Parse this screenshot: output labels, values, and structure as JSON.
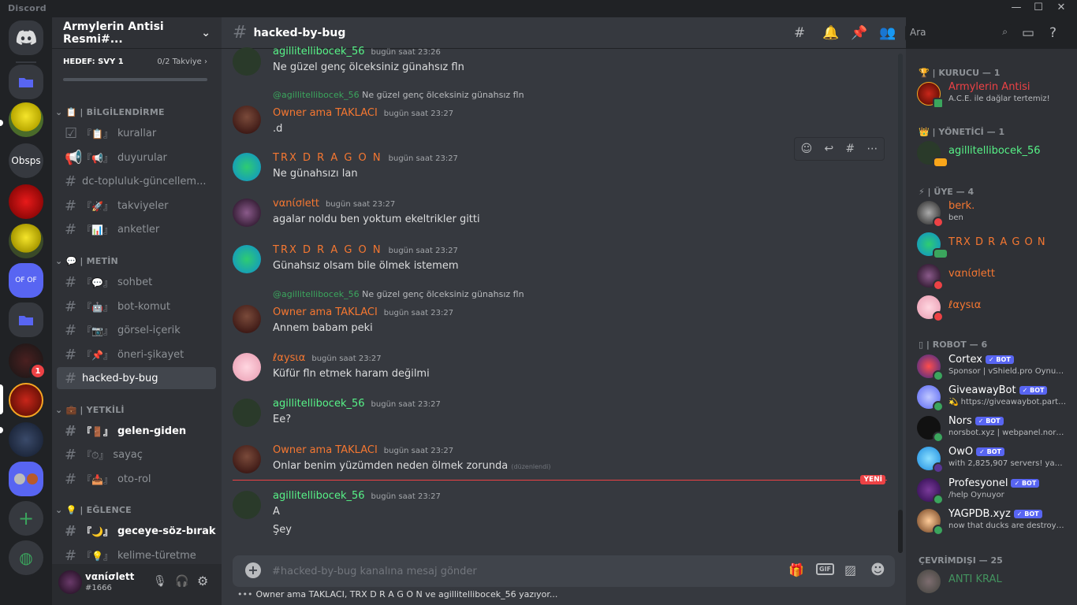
{
  "app": {
    "name": "Discord",
    "win_min": "—",
    "win_max": "☐",
    "win_close": "✕"
  },
  "rail": {
    "servers": [
      {
        "label": "Obsps"
      },
      {
        "badge": "1"
      }
    ]
  },
  "guild": {
    "name": "Armylerin Antisi Resmi#...",
    "boost_goal": "HEDEF: SVY 1",
    "boost_count": "0/2 Takviye ›"
  },
  "sidebar": {
    "categories": [
      {
        "label": "📋 | BİLGİLENDİRME"
      },
      {
        "label": "💬 | METİN"
      },
      {
        "label": "💼 | YETKİLİ"
      },
      {
        "label": "💡 | EĞLENCE"
      }
    ],
    "channels": [
      {
        "label": "kurallar",
        "emoji": "『📋』"
      },
      {
        "label": "duyurular",
        "emoji": "『📢』"
      },
      {
        "label": "dc-topluluk-güncellem..."
      },
      {
        "label": "takviyeler",
        "emoji": "『🚀』"
      },
      {
        "label": "anketler",
        "emoji": "『📊』"
      },
      {
        "label": "sohbet",
        "emoji": "『💬』"
      },
      {
        "label": "bot-komut",
        "emoji": "『🤖』"
      },
      {
        "label": "görsel-içerik",
        "emoji": "『📷』"
      },
      {
        "label": "öneri-şikayet",
        "emoji": "『📌』"
      },
      {
        "label": "hacked-by-bug"
      },
      {
        "label": "gelen-giden",
        "emoji": "『🚪』"
      },
      {
        "label": "sayaç",
        "emoji": "『⏱』"
      },
      {
        "label": "oto-rol",
        "emoji": "『📥』"
      },
      {
        "label": "geceye-söz-bırak",
        "emoji": "『🌙』"
      },
      {
        "label": "kelime-türetme",
        "emoji": "『💡』"
      }
    ]
  },
  "user": {
    "name": "vαnίσlett",
    "tag": "#1666"
  },
  "chat": {
    "channel": "hacked-by-bug",
    "search_placeholder": "Ara",
    "composer_placeholder": "#hacked-by-bug kanalına mesaj gönder",
    "new_label": "YENİ",
    "edited": "(düzenlendi)",
    "typing_users": "Owner ama TAKLACI, TRX D R A G O N ve agillitellibocek_56 yazıyor...",
    "messages": [
      {
        "author": "agillitellibocek_56",
        "time": "bugün saat 23:26",
        "text": "Ne güzel genç ölceksiniz günahsız fln"
      },
      {
        "reply_author": "@agillitellibocek_56",
        "reply_text": "Ne güzel genç ölceksiniz günahsız fln",
        "author": "Owner ama TAKLACI",
        "time": "bugün saat 23:27",
        "text": ".d"
      },
      {
        "author": "TRX D R A G O N",
        "time": "bugün saat 23:27",
        "text": "Ne günahsızı lan"
      },
      {
        "author": "vαnίσlett",
        "time": "bugün saat 23:27",
        "text": "agalar noldu ben yoktum ekeltrikler gitti"
      },
      {
        "author": "TRX D R A G O N",
        "time": "bugün saat 23:27",
        "text": "Günahsız olsam bile ölmek istemem"
      },
      {
        "reply_author": "@agillitellibocek_56",
        "reply_text": "Ne güzel genç ölceksiniz günahsız fln",
        "author": "Owner ama TAKLACI",
        "time": "bugün saat 23:27",
        "text": "Annem babam peki"
      },
      {
        "author": "ℓαуѕια",
        "time": "bugün saat 23:27",
        "text": "Küfür fln etmek haram değilmi"
      },
      {
        "author": "agillitellibocek_56",
        "time": "bugün saat 23:27",
        "text": "Ee?"
      },
      {
        "author": "Owner ama TAKLACI",
        "time": "bugün saat 23:27",
        "text": "Onlar benim yüzümden neden ölmek zorunda"
      },
      {
        "author": "agillitellibocek_56",
        "time": "bugün saat 23:27",
        "text": "A",
        "text2": "Şey"
      }
    ]
  },
  "members": {
    "categories": [
      {
        "label": "🏆 | KURUCU — 1"
      },
      {
        "label": "👑 | YÖNETİCİ — 1"
      },
      {
        "label": "⚡ | ÜYE — 4"
      },
      {
        "label": "▯ | ROBOT — 6"
      },
      {
        "label": "ÇEVRİMDIŞI — 25"
      }
    ],
    "list": [
      {
        "name": "Armylerin Antisi",
        "sub": "A.C.E. ile dağlar tertemiz!",
        "color": "#ed4245"
      },
      {
        "name": "agillitellibocek_56",
        "color": "#57f287"
      },
      {
        "name": "berk.",
        "sub": "ben",
        "color": "#f57731"
      },
      {
        "name": "TRX D R A G O N",
        "color": "#f57731"
      },
      {
        "name": "vαnίσlett",
        "color": "#f57731"
      },
      {
        "name": "ℓαуѕια",
        "color": "#f57731"
      },
      {
        "name": "Cortex",
        "sub": "Sponsor | vShield.pro Oynuyor",
        "color": "#ffffff"
      },
      {
        "name": "GiveawayBot",
        "sub": "💫 https://giveawaybot.party ...",
        "color": "#ffffff"
      },
      {
        "name": "Nors",
        "sub": "norsbot.xyz | webpanel.norsbo...",
        "color": "#ffffff"
      },
      {
        "name": "OwO",
        "sub": "with 2,825,907 servers! yayında",
        "color": "#ffffff"
      },
      {
        "name": "Profesyonel",
        "sub": "/help Oynuyor",
        "color": "#ffffff"
      },
      {
        "name": "YAGPDB.xyz",
        "sub": "now that ducks are destroyed, ...",
        "color": "#ffffff"
      },
      {
        "name": "ANTI KRAL",
        "color": "#57f287"
      }
    ],
    "bot_label": "✓ BOT"
  },
  "colors": {
    "orange": "#f57731",
    "green": "#57f287",
    "red": "#ed4245",
    "blurple": "#5865f2"
  }
}
